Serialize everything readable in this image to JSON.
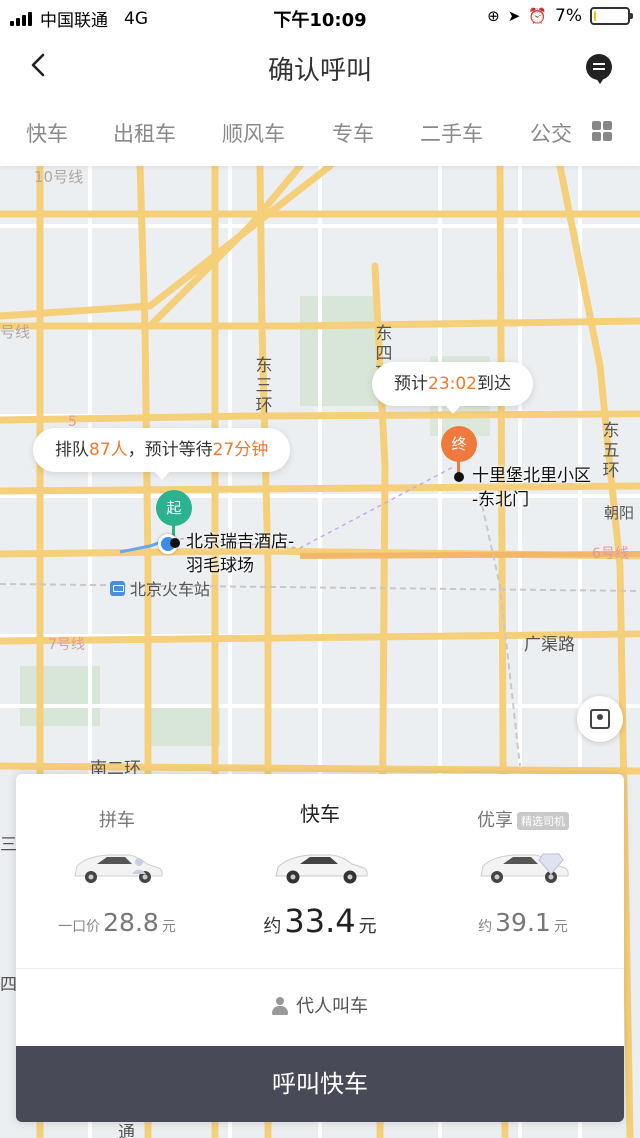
{
  "status_bar": {
    "carrier": "中国联通",
    "network": "4G",
    "time": "下午10:09",
    "battery": "7%",
    "battery_level": 0.07
  },
  "header": {
    "title": "确认呼叫"
  },
  "tabs": [
    {
      "label": "快车",
      "active": true
    },
    {
      "label": "出租车",
      "active": false
    },
    {
      "label": "顺风车",
      "active": false
    },
    {
      "label": "专车",
      "active": false
    },
    {
      "label": "二手车",
      "active": false
    },
    {
      "label": "公交",
      "active": false
    }
  ],
  "map": {
    "labels": {
      "line10": "10号线",
      "line_left": "号线",
      "east4": "东四环",
      "east3": "东三环",
      "east5": "东五环",
      "chaoyang": "朝阳",
      "line6": "6号线",
      "line7": "7号线",
      "guangqu": "广渠路",
      "south2": "南二环",
      "num5": "5",
      "left_san": "三",
      "left_si": "四",
      "bottom": "通"
    },
    "station": "北京火车站",
    "queue_bubble": {
      "prefix": "排队",
      "count": "87人",
      "middle": "，预计等待",
      "wait": "27分钟"
    },
    "eta_bubble": {
      "prefix": "预计",
      "time": "23:02",
      "suffix": "到达"
    },
    "start": {
      "pin": "起",
      "name_line1": "北京瑞吉酒店-",
      "name_line2": "羽毛球场"
    },
    "end": {
      "pin": "终",
      "name_line1": "十里堡北里小区",
      "name_line2": "-东北门"
    }
  },
  "options": [
    {
      "name": "拼车",
      "badge": "",
      "price_prefix": "一口价",
      "price": "28.8",
      "unit": "元",
      "active": false
    },
    {
      "name": "快车",
      "badge": "",
      "price_prefix": "约",
      "price": "33.4",
      "unit": "元",
      "active": true
    },
    {
      "name": "优享",
      "badge": "精选司机",
      "price_prefix": "约",
      "price": "39.1",
      "unit": "元",
      "active": false
    }
  ],
  "proxy_call": "代人叫车",
  "call_button": "呼叫快车",
  "colors": {
    "accent": "#f07a2e",
    "start_pin": "#2bb28e",
    "end_pin": "#f07a3e",
    "call_button": "#494a58"
  }
}
